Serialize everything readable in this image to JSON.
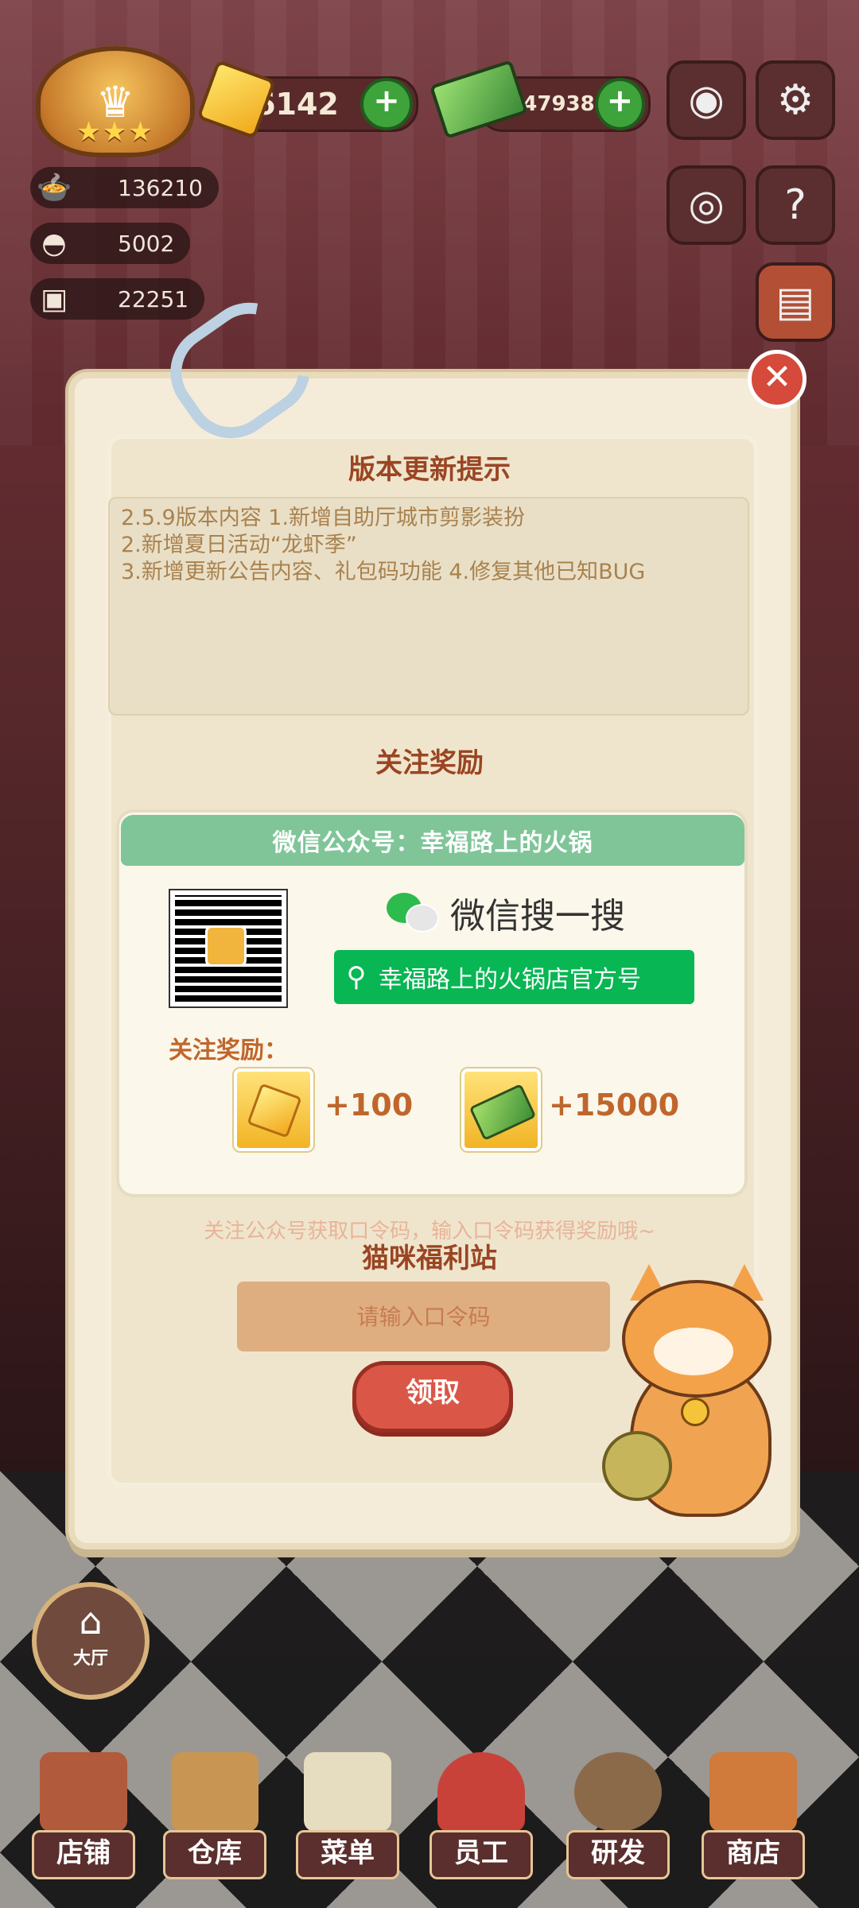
{
  "hud": {
    "gems": "6142",
    "cash": "22347938",
    "stats": [
      "136210",
      "5002",
      "22251"
    ],
    "icons": {
      "camera": "camera-icon",
      "settings": "gear-icon",
      "eye": "eye-icon",
      "guide": "book-question-icon",
      "recipe_book": "recipe-book-icon"
    }
  },
  "modal": {
    "title": "版本更新提示",
    "notes": [
      "2.5.9版本内容    1.新增自助厅城市剪影装扮",
      "2.新增夏日活动“龙虾季”",
      "3.新增更新公告内容、礼包码功能    4.修复其他已知BUG"
    ],
    "follow_title": "关注奖励",
    "wechat_banner": "微信公众号：幸福路上的火锅",
    "wechat_search_label": "微信搜一搜",
    "search_text": "幸福路上的火锅店官方号",
    "reward_label": "关注奖励：",
    "rewards": [
      {
        "icon": "gem-icon",
        "value": "+100"
      },
      {
        "icon": "cash-icon",
        "value": "+15000"
      }
    ],
    "hint": "关注公众号获取口令码，输入口令码获得奖励哦~",
    "station_title": "猫咪福利站",
    "code_placeholder": "请输入口令码",
    "claim_label": "领取"
  },
  "hall_label": "大厅",
  "nav": [
    {
      "label": "店铺",
      "icon": "shop-building-icon"
    },
    {
      "label": "仓库",
      "icon": "warehouse-boxes-icon"
    },
    {
      "label": "菜单",
      "icon": "menu-clipboard-icon"
    },
    {
      "label": "员工",
      "icon": "staff-chef-icon"
    },
    {
      "label": "研发",
      "icon": "research-pot-icon"
    },
    {
      "label": "商店",
      "icon": "store-icon"
    }
  ],
  "colors": {
    "accent_red": "#da5747",
    "wechat_green": "#08b654",
    "title_brown": "#9a4523",
    "reward_orange": "#c0662c"
  }
}
